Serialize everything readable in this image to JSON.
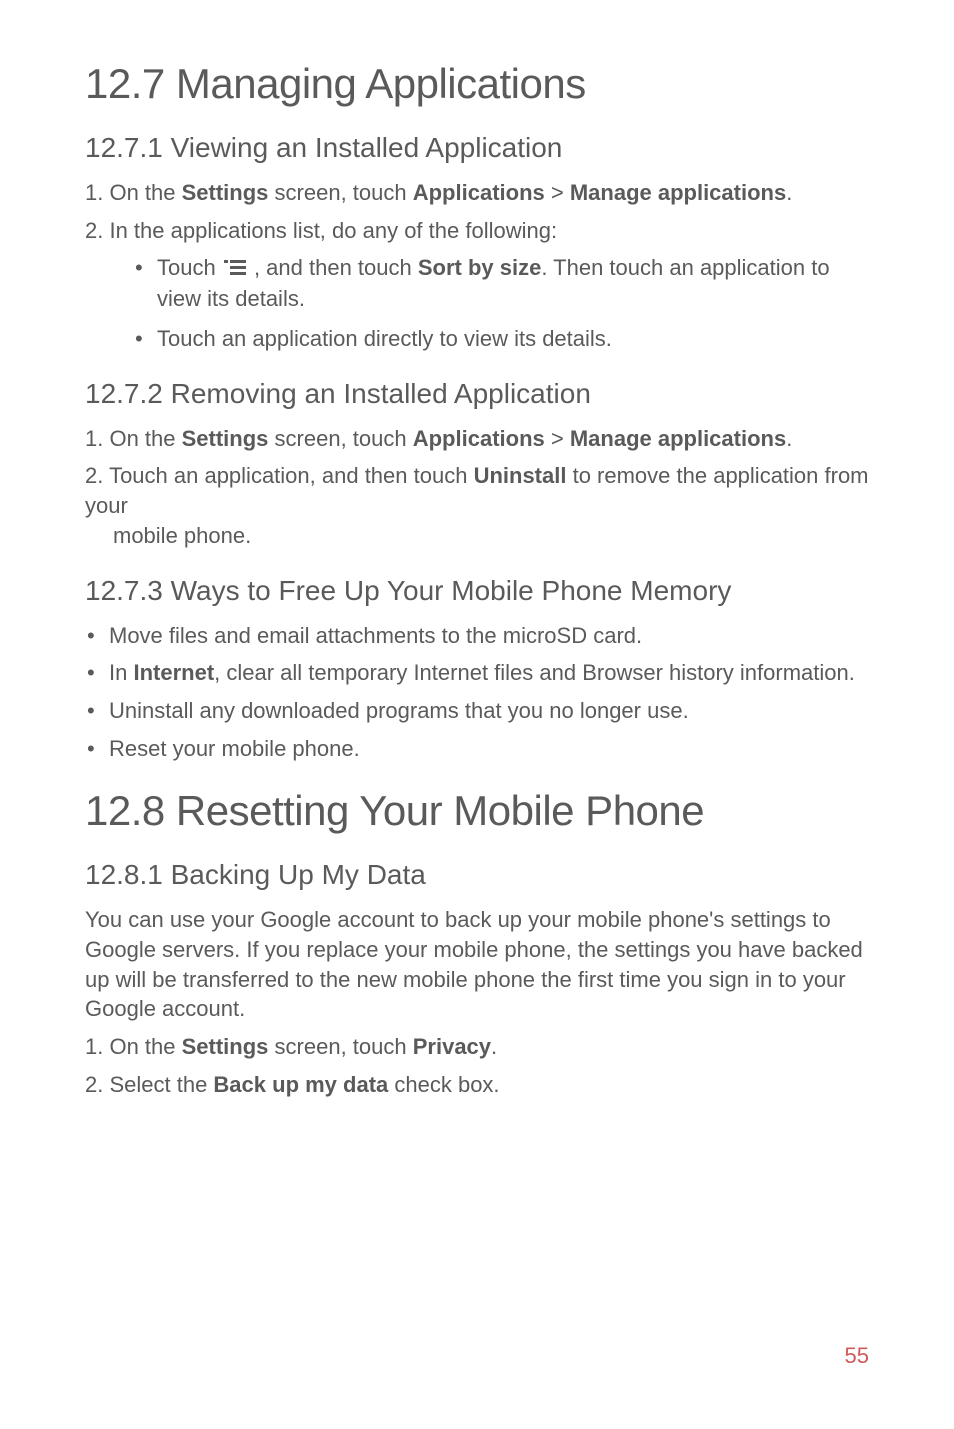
{
  "s127": {
    "title": "12.7  Managing Applications",
    "s1271": {
      "heading": "12.7.1  Viewing an Installed Application",
      "step1_prefix": "1. On the ",
      "step1_bold1": "Settings",
      "step1_mid1": " screen, touch ",
      "step1_bold2": "Applications",
      "step1_mid2": " > ",
      "step1_bold3": "Manage applications",
      "step1_suffix": ".",
      "step2": "2. In the applications list, do any of the following:",
      "bullet1_prefix": "Touch  ",
      "bullet1_mid1": " , and then touch ",
      "bullet1_bold": "Sort by size",
      "bullet1_suffix": ". Then touch an application to view its details.",
      "bullet2": "Touch an application directly to view its details."
    },
    "s1272": {
      "heading": "12.7.2  Removing an Installed Application",
      "step1_prefix": "1. On the ",
      "step1_bold1": "Settings",
      "step1_mid1": " screen, touch ",
      "step1_bold2": "Applications",
      "step1_mid2": " > ",
      "step1_bold3": "Manage applications",
      "step1_suffix": ".",
      "step2_prefix": "2. Touch an application, and then touch ",
      "step2_bold": "Uninstall",
      "step2_suffix": " to remove the application from your",
      "step2_line2": "mobile phone."
    },
    "s1273": {
      "heading": "12.7.3  Ways to Free Up Your Mobile Phone Memory",
      "b1": "Move files and email attachments to the microSD card.",
      "b2_prefix": "In ",
      "b2_bold": "Internet",
      "b2_suffix": ", clear all temporary Internet files and Browser history information.",
      "b3": "Uninstall any downloaded programs that you no longer use.",
      "b4": "Reset your mobile phone."
    }
  },
  "s128": {
    "title": "12.8  Resetting Your Mobile Phone",
    "s1281": {
      "heading": "12.8.1  Backing Up My Data",
      "para": "You can use your Google account to back up your mobile phone's settings to Google servers. If you replace your mobile phone, the settings you have backed up will be transferred to the new mobile phone the first time you sign in to your Google account.",
      "step1_prefix": "1. On the ",
      "step1_bold1": "Settings",
      "step1_mid1": " screen, touch ",
      "step1_bold2": "Privacy",
      "step1_suffix": ".",
      "step2_prefix": "2. Select the ",
      "step2_bold": "Back up my data",
      "step2_suffix": " check box."
    }
  },
  "page_number": "55"
}
